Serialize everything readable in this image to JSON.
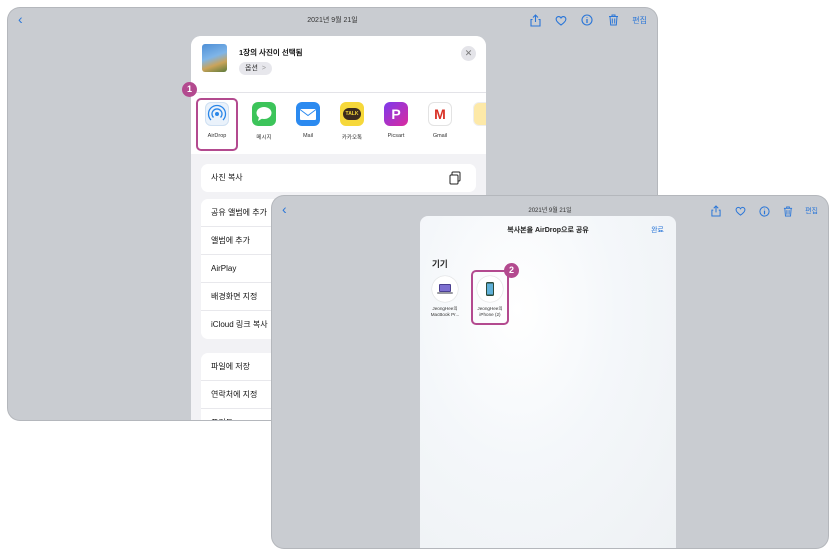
{
  "colors": {
    "accent": "#2a76d8",
    "highlight": "#b34a8f",
    "backdrop": "#c9ccd1"
  },
  "screen1": {
    "date": "2021년 9월 21일",
    "edit_label": "편집",
    "share_sheet": {
      "selection_title": "1장의 사진이 선택됨",
      "options_label": "옵션",
      "options_chevron": ">",
      "close_glyph": "✕",
      "apps": [
        {
          "label": "AirDrop",
          "icon": "airdrop-icon"
        },
        {
          "label": "메시지",
          "icon": "messages-icon"
        },
        {
          "label": "Mail",
          "icon": "mail-icon"
        },
        {
          "label": "카카오톡",
          "icon": "kakaotalk-icon"
        },
        {
          "label": "Picsart",
          "icon": "picsart-icon"
        },
        {
          "label": "Gmail",
          "icon": "gmail-icon"
        }
      ],
      "kakao_badge_text": "TALK",
      "picsart_letter": "P",
      "gmail_letter": "M",
      "copy_row": "사진 복사",
      "group2": [
        "공유 앨범에 추가",
        "앨범에 추가",
        "AirPlay",
        "배경화면 지정",
        "iCloud 링크 복사"
      ],
      "group3": [
        "파일에 저장",
        "연락처에 지정",
        "프린트"
      ]
    },
    "step_badge": "1"
  },
  "screen2": {
    "date": "2021년 9월 21일",
    "edit_label": "편집",
    "airdrop": {
      "title": "복사본을 AirDrop으로 공유",
      "done_label": "완료",
      "section_label": "기기",
      "devices": [
        {
          "name_line1": "JeongHee의",
          "name_line2": "MacBook Pr...",
          "icon": "macbook-icon"
        },
        {
          "name_line1": "JeongHee의",
          "name_line2": "iPhone (2)",
          "icon": "iphone-icon"
        }
      ]
    },
    "step_badge": "2"
  }
}
